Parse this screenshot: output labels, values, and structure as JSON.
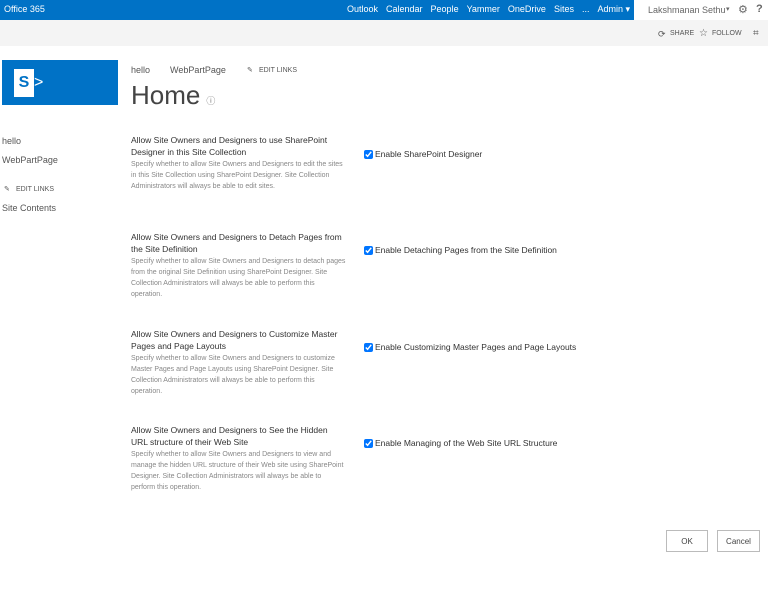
{
  "topbar": {
    "brand": "Office 365",
    "nav": [
      "Outlook",
      "Calendar",
      "People",
      "Yammer",
      "OneDrive",
      "Sites",
      "...",
      "Admin ▾"
    ],
    "user": "Lakshmanan Sethu",
    "user_caret": "▾",
    "gear": "⚙",
    "help": "?"
  },
  "actions": {
    "share": "SHARE",
    "follow": "FOLLOW",
    "focus": "⌗"
  },
  "header": {
    "crumbs": [
      "hello",
      "WebPartPage"
    ],
    "edit_links": "EDIT LINKS",
    "title": "Home",
    "info": "ⓘ"
  },
  "quicklaunch": {
    "items": [
      "hello",
      "WebPartPage"
    ],
    "edit_links": "EDIT LINKS",
    "site_contents": "Site Contents"
  },
  "sections": [
    {
      "title": "Allow Site Owners and Designers to use SharePoint Designer in this Site Collection",
      "desc": "Specify whether to allow Site Owners and Designers to edit the sites in this Site Collection using SharePoint Designer. Site Collection Administrators will always be able to edit sites.",
      "checkbox": "Enable SharePoint Designer",
      "checked": true
    },
    {
      "title": "Allow Site Owners and Designers to Detach Pages from the Site Definition",
      "desc": "Specify whether to allow Site Owners and Designers to detach pages from the original Site Definition using SharePoint Designer. Site Collection Administrators will always be able to perform this operation.",
      "checkbox": "Enable Detaching Pages from the Site Definition",
      "checked": true
    },
    {
      "title": "Allow Site Owners and Designers to Customize Master Pages and Page Layouts",
      "desc": "Specify whether to allow Site Owners and Designers to customize Master Pages and Page Layouts using SharePoint Designer. Site Collection Administrators will always be able to perform this operation.",
      "checkbox": "Enable Customizing Master Pages and Page Layouts",
      "checked": true
    },
    {
      "title": "Allow Site Owners and Designers to See the Hidden URL structure of their Web Site",
      "desc": "Specify whether to allow Site Owners and Designers to view and manage the hidden URL structure of their Web site using SharePoint Designer. Site Collection Administrators will always be able to perform this operation.",
      "checkbox": "Enable Managing of the Web Site URL Structure",
      "checked": true
    }
  ],
  "buttons": {
    "ok": "OK",
    "cancel": "Cancel"
  }
}
